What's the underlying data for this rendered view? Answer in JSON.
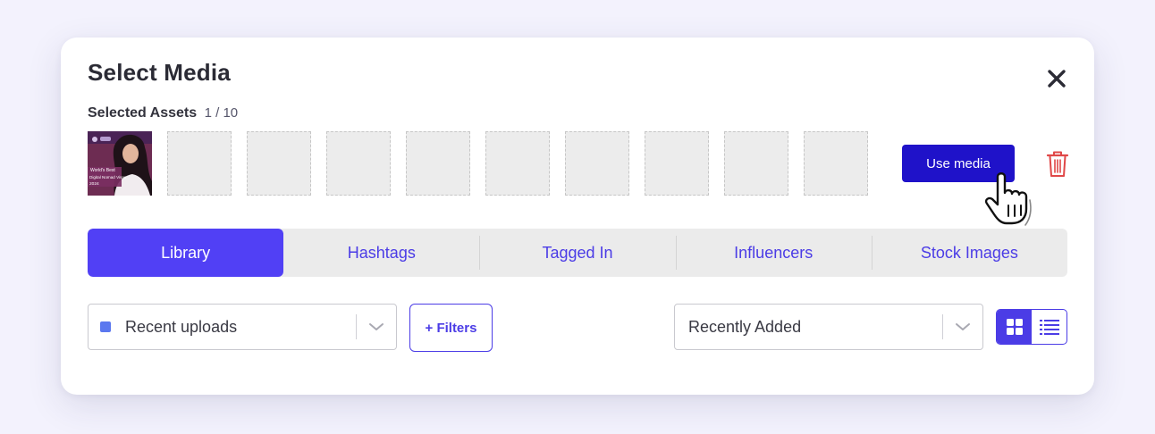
{
  "modal": {
    "title": "Select Media",
    "close_icon": "close-icon",
    "selected_assets": {
      "label": "Selected Assets",
      "count": "1 / 10",
      "slots_total": 10,
      "slots_filled": 1,
      "thumbnail_text": [
        "World's Best",
        "Digital Nomad Visas",
        "2024"
      ]
    },
    "use_media_label": "Use media",
    "trash_icon": "trash-icon",
    "cursor_icon": "hand-pointer-icon",
    "tabs": [
      {
        "label": "Library",
        "active": true
      },
      {
        "label": "Hashtags",
        "active": false
      },
      {
        "label": "Tagged In",
        "active": false
      },
      {
        "label": "Influencers",
        "active": false
      },
      {
        "label": "Stock Images",
        "active": false
      }
    ],
    "source_select": {
      "value": "Recent uploads",
      "swatch_color": "#5b78ef"
    },
    "filters_label": "+ Filters",
    "sort_select": {
      "value": "Recently Added"
    },
    "view_toggle": {
      "grid_icon": "grid-view-icon",
      "list_icon": "list-view-icon",
      "active": "grid"
    }
  },
  "colors": {
    "accent": "#5140f5",
    "primary_button": "#1f12c9",
    "danger": "#e04848",
    "background": "#f3f2fd"
  }
}
